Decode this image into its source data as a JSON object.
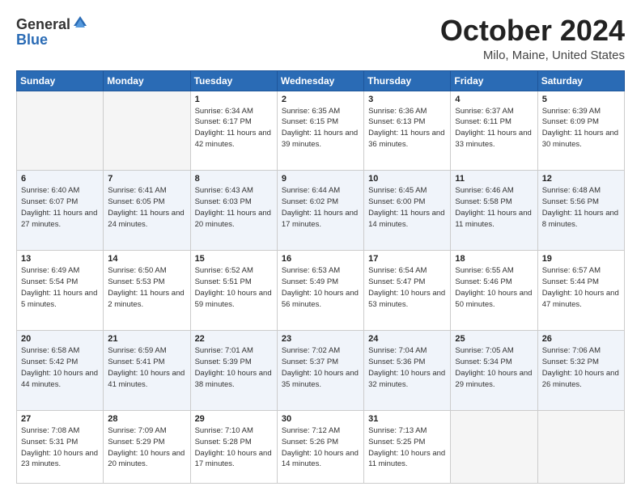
{
  "header": {
    "logo": {
      "general": "General",
      "blue": "Blue"
    },
    "title": "October 2024",
    "location": "Milo, Maine, United States"
  },
  "days_of_week": [
    "Sunday",
    "Monday",
    "Tuesday",
    "Wednesday",
    "Thursday",
    "Friday",
    "Saturday"
  ],
  "weeks": [
    [
      {
        "day": null,
        "info": null
      },
      {
        "day": null,
        "info": null
      },
      {
        "day": "1",
        "info": "Sunrise: 6:34 AM\nSunset: 6:17 PM\nDaylight: 11 hours and 42 minutes."
      },
      {
        "day": "2",
        "info": "Sunrise: 6:35 AM\nSunset: 6:15 PM\nDaylight: 11 hours and 39 minutes."
      },
      {
        "day": "3",
        "info": "Sunrise: 6:36 AM\nSunset: 6:13 PM\nDaylight: 11 hours and 36 minutes."
      },
      {
        "day": "4",
        "info": "Sunrise: 6:37 AM\nSunset: 6:11 PM\nDaylight: 11 hours and 33 minutes."
      },
      {
        "day": "5",
        "info": "Sunrise: 6:39 AM\nSunset: 6:09 PM\nDaylight: 11 hours and 30 minutes."
      }
    ],
    [
      {
        "day": "6",
        "info": "Sunrise: 6:40 AM\nSunset: 6:07 PM\nDaylight: 11 hours and 27 minutes."
      },
      {
        "day": "7",
        "info": "Sunrise: 6:41 AM\nSunset: 6:05 PM\nDaylight: 11 hours and 24 minutes."
      },
      {
        "day": "8",
        "info": "Sunrise: 6:43 AM\nSunset: 6:03 PM\nDaylight: 11 hours and 20 minutes."
      },
      {
        "day": "9",
        "info": "Sunrise: 6:44 AM\nSunset: 6:02 PM\nDaylight: 11 hours and 17 minutes."
      },
      {
        "day": "10",
        "info": "Sunrise: 6:45 AM\nSunset: 6:00 PM\nDaylight: 11 hours and 14 minutes."
      },
      {
        "day": "11",
        "info": "Sunrise: 6:46 AM\nSunset: 5:58 PM\nDaylight: 11 hours and 11 minutes."
      },
      {
        "day": "12",
        "info": "Sunrise: 6:48 AM\nSunset: 5:56 PM\nDaylight: 11 hours and 8 minutes."
      }
    ],
    [
      {
        "day": "13",
        "info": "Sunrise: 6:49 AM\nSunset: 5:54 PM\nDaylight: 11 hours and 5 minutes."
      },
      {
        "day": "14",
        "info": "Sunrise: 6:50 AM\nSunset: 5:53 PM\nDaylight: 11 hours and 2 minutes."
      },
      {
        "day": "15",
        "info": "Sunrise: 6:52 AM\nSunset: 5:51 PM\nDaylight: 10 hours and 59 minutes."
      },
      {
        "day": "16",
        "info": "Sunrise: 6:53 AM\nSunset: 5:49 PM\nDaylight: 10 hours and 56 minutes."
      },
      {
        "day": "17",
        "info": "Sunrise: 6:54 AM\nSunset: 5:47 PM\nDaylight: 10 hours and 53 minutes."
      },
      {
        "day": "18",
        "info": "Sunrise: 6:55 AM\nSunset: 5:46 PM\nDaylight: 10 hours and 50 minutes."
      },
      {
        "day": "19",
        "info": "Sunrise: 6:57 AM\nSunset: 5:44 PM\nDaylight: 10 hours and 47 minutes."
      }
    ],
    [
      {
        "day": "20",
        "info": "Sunrise: 6:58 AM\nSunset: 5:42 PM\nDaylight: 10 hours and 44 minutes."
      },
      {
        "day": "21",
        "info": "Sunrise: 6:59 AM\nSunset: 5:41 PM\nDaylight: 10 hours and 41 minutes."
      },
      {
        "day": "22",
        "info": "Sunrise: 7:01 AM\nSunset: 5:39 PM\nDaylight: 10 hours and 38 minutes."
      },
      {
        "day": "23",
        "info": "Sunrise: 7:02 AM\nSunset: 5:37 PM\nDaylight: 10 hours and 35 minutes."
      },
      {
        "day": "24",
        "info": "Sunrise: 7:04 AM\nSunset: 5:36 PM\nDaylight: 10 hours and 32 minutes."
      },
      {
        "day": "25",
        "info": "Sunrise: 7:05 AM\nSunset: 5:34 PM\nDaylight: 10 hours and 29 minutes."
      },
      {
        "day": "26",
        "info": "Sunrise: 7:06 AM\nSunset: 5:32 PM\nDaylight: 10 hours and 26 minutes."
      }
    ],
    [
      {
        "day": "27",
        "info": "Sunrise: 7:08 AM\nSunset: 5:31 PM\nDaylight: 10 hours and 23 minutes."
      },
      {
        "day": "28",
        "info": "Sunrise: 7:09 AM\nSunset: 5:29 PM\nDaylight: 10 hours and 20 minutes."
      },
      {
        "day": "29",
        "info": "Sunrise: 7:10 AM\nSunset: 5:28 PM\nDaylight: 10 hours and 17 minutes."
      },
      {
        "day": "30",
        "info": "Sunrise: 7:12 AM\nSunset: 5:26 PM\nDaylight: 10 hours and 14 minutes."
      },
      {
        "day": "31",
        "info": "Sunrise: 7:13 AM\nSunset: 5:25 PM\nDaylight: 10 hours and 11 minutes."
      },
      {
        "day": null,
        "info": null
      },
      {
        "day": null,
        "info": null
      }
    ]
  ]
}
